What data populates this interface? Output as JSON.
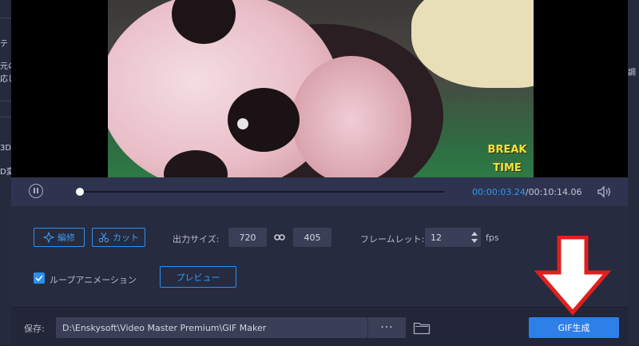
{
  "background": {
    "left_texts": [
      "テ",
      "元の",
      "応じ",
      "3D",
      "D変"
    ],
    "right_texts": [
      "調"
    ]
  },
  "video": {
    "overlay_line1": "BREAK",
    "overlay_line2": "TIME"
  },
  "player": {
    "progress": 0.005,
    "current_time": "00:00:03.24",
    "total_time": "/00:10:14.06"
  },
  "tools": {
    "edit_label": "編修",
    "cut_label": "カット"
  },
  "output": {
    "size_label": "出力サイズ:",
    "width": "720",
    "height": "405",
    "framerate_label": "フレームレット:",
    "framerate": "12",
    "fps_unit": "fps"
  },
  "loop": {
    "label": "ループアニメーション",
    "checked": true
  },
  "preview_label": "プレビュー",
  "footer": {
    "save_label": "保存:",
    "path": "D:\\Enskysoft\\Video Master Premium\\GIF Maker",
    "more_label": "···",
    "generate_label": "GIF生成"
  },
  "colors": {
    "accent": "#2c8ff0",
    "annotation": "#e0201e"
  }
}
